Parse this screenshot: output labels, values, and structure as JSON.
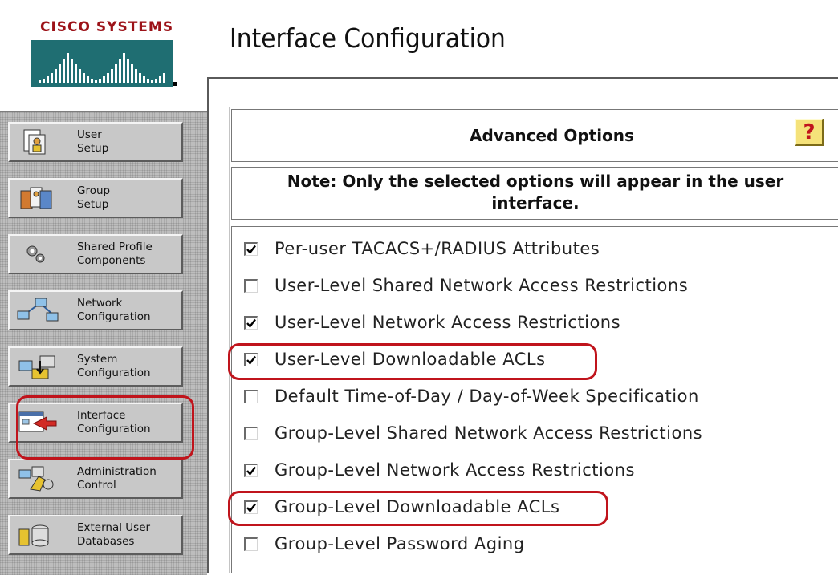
{
  "brand": {
    "name": "Cisco Systems",
    "logo_text": "CISCO SYSTEMS"
  },
  "page": {
    "title": "Interface Configuration"
  },
  "sidebar": {
    "items": [
      {
        "label": "User\nSetup",
        "icon": "user-setup-icon"
      },
      {
        "label": "Group\nSetup",
        "icon": "group-setup-icon"
      },
      {
        "label": "Shared Profile\nComponents",
        "icon": "shared-profile-icon"
      },
      {
        "label": "Network\nConfiguration",
        "icon": "network-config-icon"
      },
      {
        "label": "System\nConfiguration",
        "icon": "system-config-icon"
      },
      {
        "label": "Interface\nConfiguration",
        "icon": "interface-config-icon",
        "highlighted": true
      },
      {
        "label": "Administration\nControl",
        "icon": "admin-control-icon"
      },
      {
        "label": "External User\nDatabases",
        "icon": "external-db-icon"
      }
    ]
  },
  "advanced": {
    "title": "Advanced Options",
    "help": "?",
    "note": "Note: Only the selected options will appear in the user\ninterface.",
    "options": [
      {
        "label": "Per-user TACACS+/RADIUS Attributes",
        "checked": true
      },
      {
        "label": "User-Level Shared Network Access Restrictions",
        "checked": false
      },
      {
        "label": "User-Level Network Access Restrictions",
        "checked": true
      },
      {
        "label": "User-Level Downloadable ACLs",
        "checked": true,
        "highlighted": true
      },
      {
        "label": "Default Time-of-Day / Day-of-Week Specification",
        "checked": false
      },
      {
        "label": "Group-Level Shared Network Access Restrictions",
        "checked": false
      },
      {
        "label": "Group-Level Network Access Restrictions",
        "checked": true
      },
      {
        "label": "Group-Level Downloadable ACLs",
        "checked": true,
        "highlighted": true
      },
      {
        "label": "Group-Level Password Aging",
        "checked": false
      }
    ]
  },
  "colors": {
    "highlight": "#c0141c",
    "logo": "#1f6e72",
    "brand_text": "#9c1218",
    "help_button": "#f5e27a"
  }
}
